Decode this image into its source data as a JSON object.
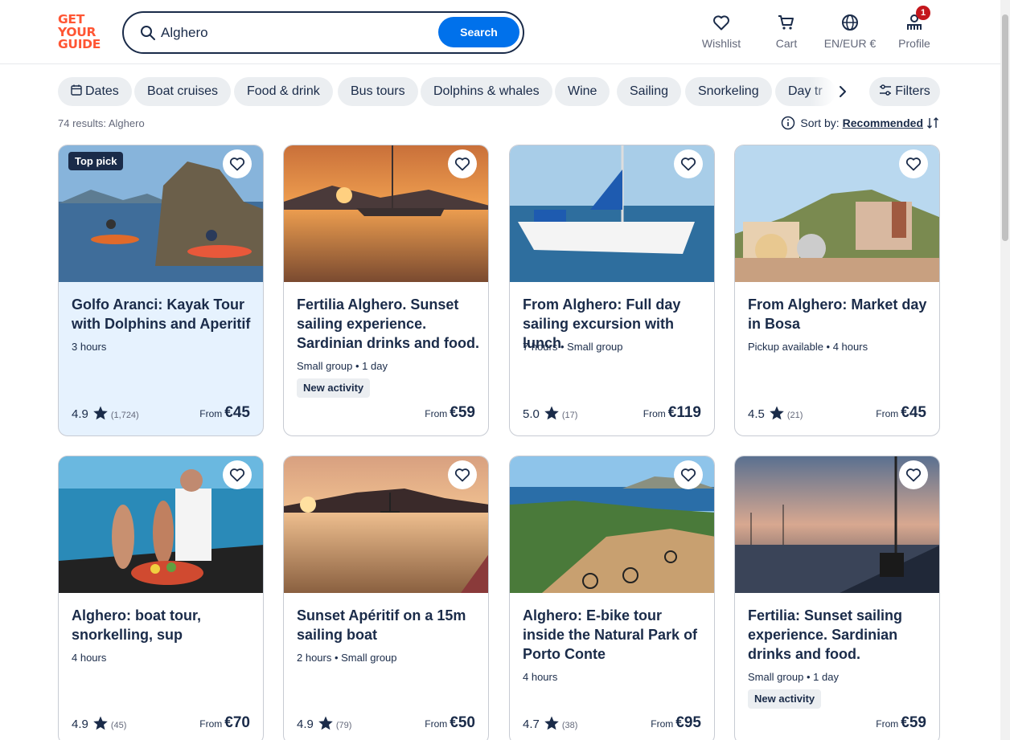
{
  "logo": {
    "line1": "GET",
    "line2": "YOUR",
    "line3": "GUIDE"
  },
  "search": {
    "value": "Alghero",
    "button": "Search"
  },
  "nav": {
    "wishlist": "Wishlist",
    "cart": "Cart",
    "lang": "EN/EUR €",
    "profile": "Profile",
    "profile_badge": "1"
  },
  "chips": [
    "Dates",
    "Boat cruises",
    "Food & drink",
    "Bus tours",
    "Dolphins & whales",
    "Wine",
    "Sailing",
    "Snorkeling",
    "Day tr"
  ],
  "filters_label": "Filters",
  "results_text": "74 results: Alghero",
  "sort": {
    "label": "Sort by:",
    "value": "Recommended"
  },
  "cards": [
    {
      "badge": "Top pick",
      "title": "Golfo Aranci: Kayak Tour with Dolphins and Aperitif",
      "meta": "3 hours",
      "rating": "4.9",
      "count": "(1,724)",
      "from": "From",
      "price": "€45",
      "highlight": true
    },
    {
      "title": "Fertilia Alghero. Sunset sailing experience. Sardinian drinks and food.",
      "meta": "Small group • 1 day",
      "new": "New activity",
      "from": "From",
      "price": "€59"
    },
    {
      "title": "From Alghero: Full day sailing excursion with lunch",
      "meta": "7 hours • Small group",
      "rating": "5.0",
      "count": "(17)",
      "from": "From",
      "price": "€119"
    },
    {
      "title": "From Alghero: Market day in Bosa",
      "meta": "Pickup available • 4 hours",
      "rating": "4.5",
      "count": "(21)",
      "from": "From",
      "price": "€45"
    },
    {
      "title": "Alghero: boat tour, snorkelling, sup",
      "meta": "4 hours",
      "rating": "4.9",
      "count": "(45)",
      "from": "From",
      "price": "€70"
    },
    {
      "title": "Sunset Apéritif on a 15m sailing boat",
      "meta": "2 hours • Small group",
      "rating": "4.9",
      "count": "(79)",
      "from": "From",
      "price": "€50"
    },
    {
      "title": "Alghero: E-bike tour inside the Natural Park of Porto Conte",
      "meta": "4 hours",
      "rating": "4.7",
      "count": "(38)",
      "from": "From",
      "price": "€95"
    },
    {
      "title": "Fertilia: Sunset sailing experience. Sardinian drinks and food.",
      "meta": "Small group • 1 day",
      "new": "New activity",
      "from": "From",
      "price": "€59"
    }
  ],
  "icons": {
    "search": "search-icon",
    "heart": "heart-icon",
    "cart": "cart-icon",
    "globe": "globe-icon",
    "profile": "profile-icon",
    "calendar": "calendar-icon",
    "chevron": "chevron-right-icon",
    "filters": "sliders-icon",
    "info": "info-icon",
    "sort": "sort-icon",
    "star": "star-icon"
  },
  "colors": {
    "brand": "#ff5533",
    "primary": "#0071eb",
    "text": "#1a2b49",
    "chip": "#ebeef1",
    "highlight": "#e6f2fe",
    "badge": "#c4161c"
  }
}
